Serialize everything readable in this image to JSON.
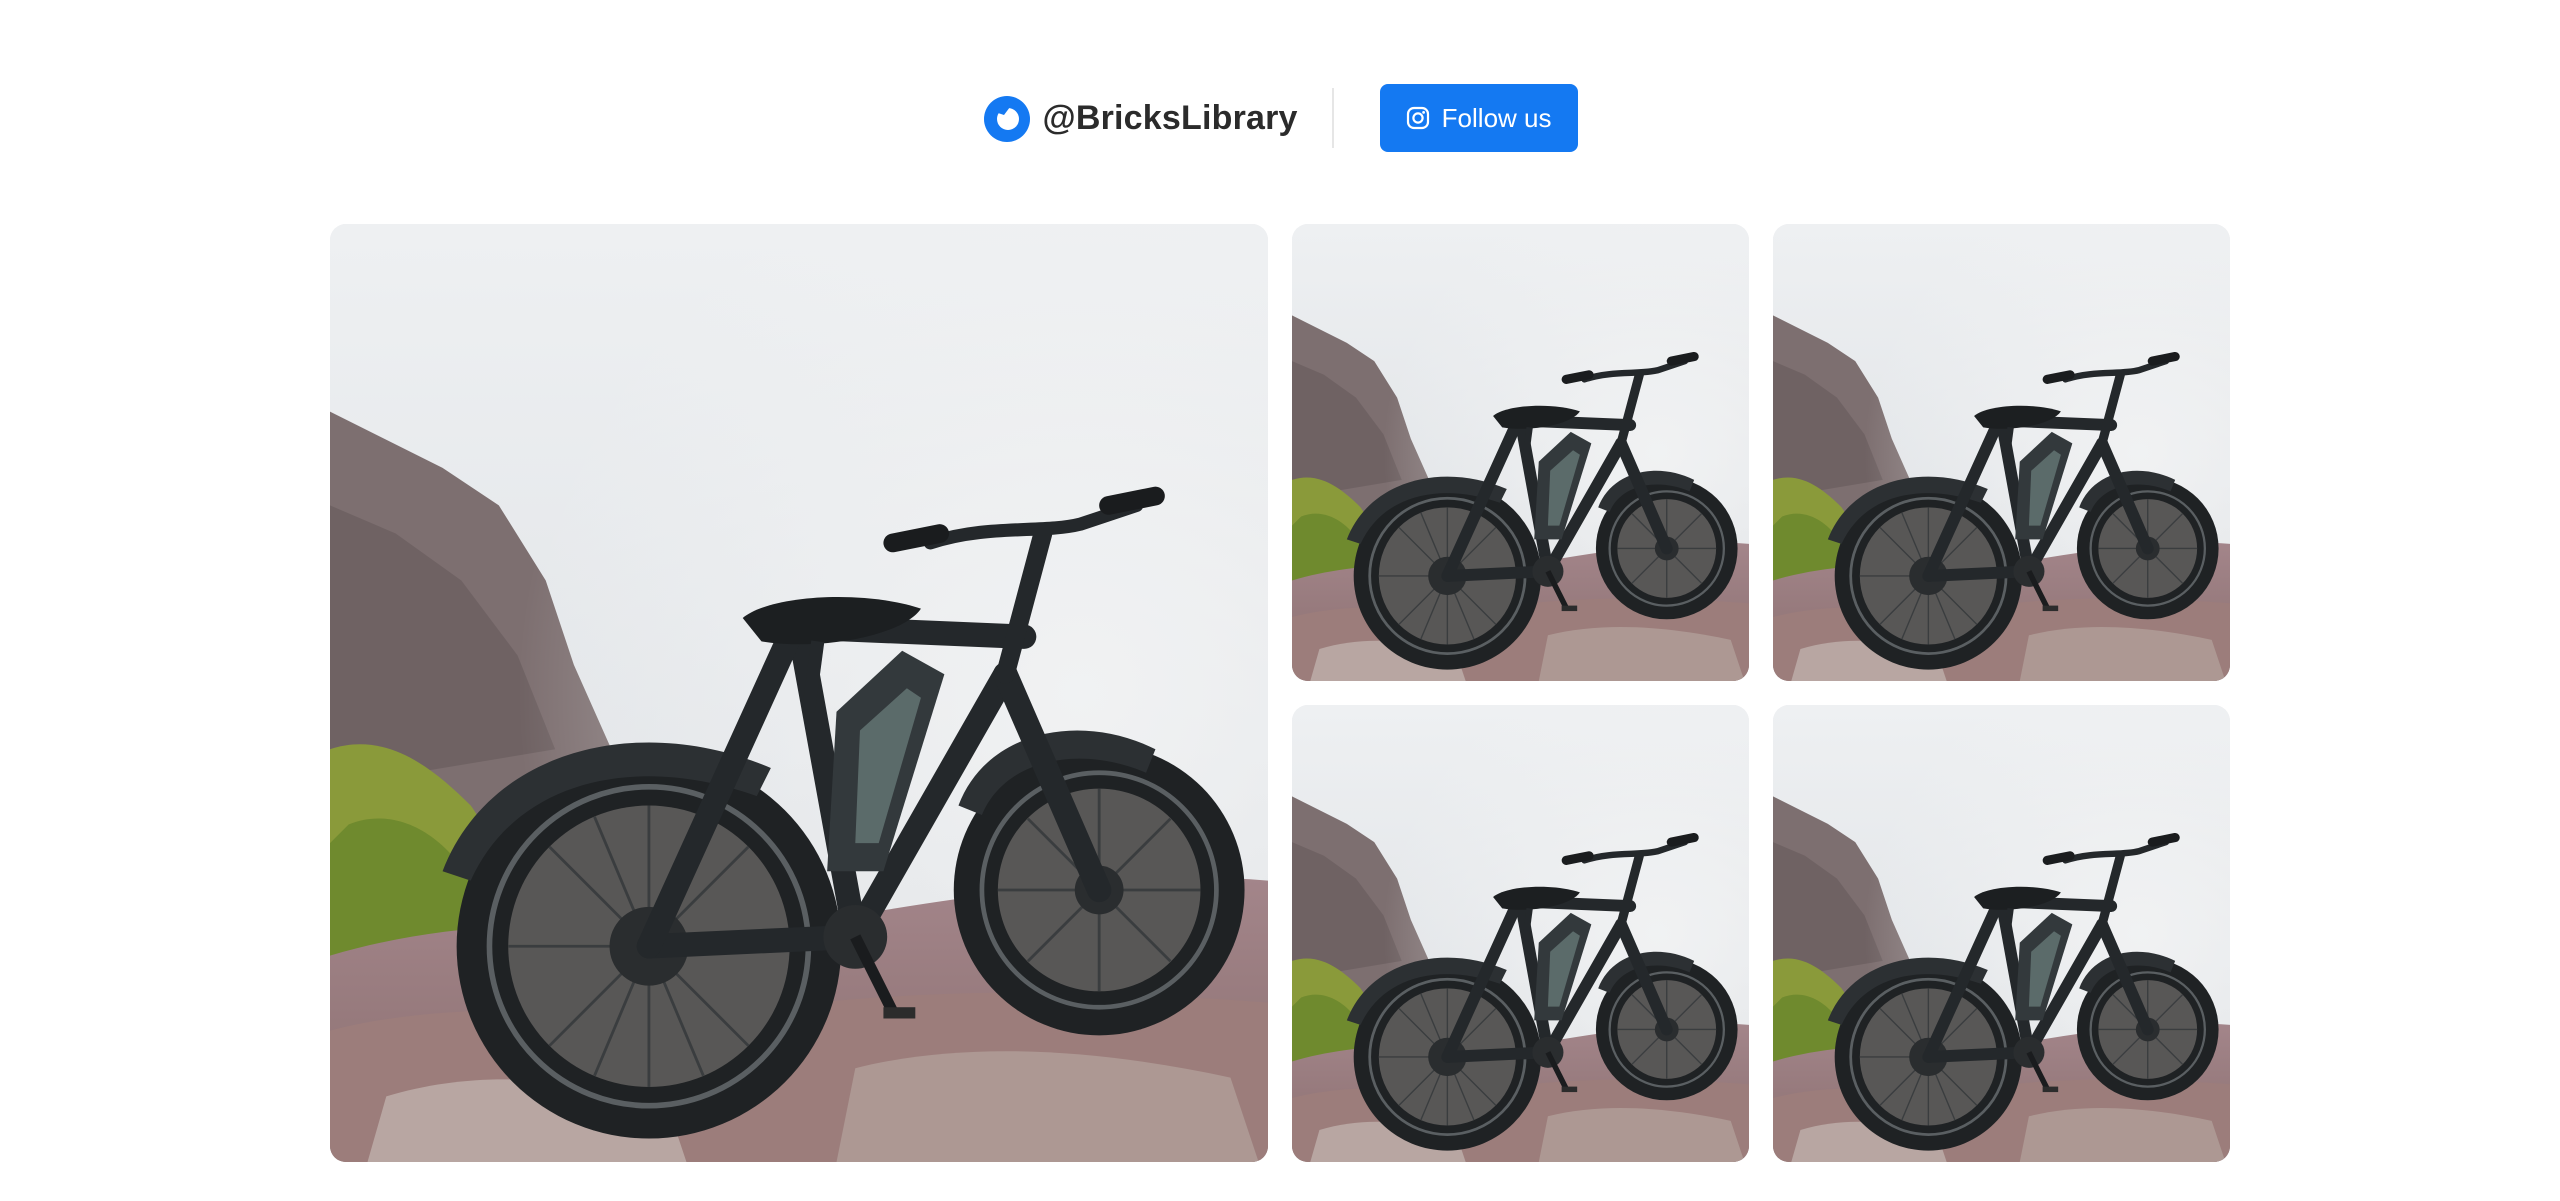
{
  "header": {
    "brand_name": "@BricksLibrary",
    "brand_icon": "bricks-logo-icon",
    "follow_label": "Follow us",
    "follow_icon": "instagram-icon",
    "accent_color": "#1479f2"
  },
  "gallery": {
    "photos": [
      {
        "icon": "bike-photo"
      },
      {
        "icon": "bike-photo"
      },
      {
        "icon": "bike-photo"
      },
      {
        "icon": "bike-photo"
      },
      {
        "icon": "bike-photo"
      }
    ]
  }
}
